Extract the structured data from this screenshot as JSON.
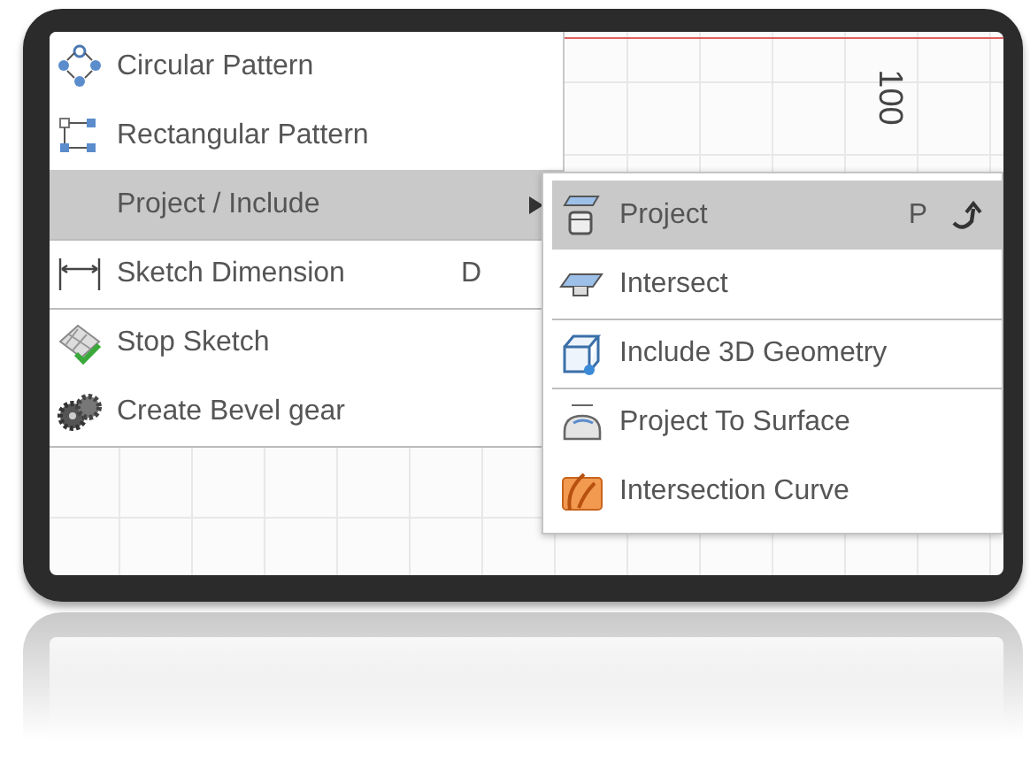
{
  "canvas": {
    "ruler_label": "100"
  },
  "menu": {
    "items": [
      {
        "label": "Circular Pattern",
        "kind": "command",
        "selected": false,
        "separated": false
      },
      {
        "label": "Rectangular Pattern",
        "kind": "command",
        "selected": false,
        "separated": false
      },
      {
        "label": "Project / Include",
        "kind": "submenu",
        "selected": true,
        "separated": false
      },
      {
        "label": "Sketch Dimension",
        "kind": "command",
        "selected": false,
        "separated": true,
        "shortcut": "D"
      },
      {
        "label": "Stop Sketch",
        "kind": "command",
        "selected": false,
        "separated": true
      },
      {
        "label": "Create Bevel gear",
        "kind": "command",
        "selected": false,
        "separated": false
      }
    ]
  },
  "submenu": {
    "items": [
      {
        "label": "Project",
        "selected": true,
        "separated": false,
        "shortcut": "P",
        "repeat": true
      },
      {
        "label": "Intersect",
        "selected": false,
        "separated": false,
        "repeat": false
      },
      {
        "label": "Include 3D Geometry",
        "selected": false,
        "separated": true,
        "repeat": false
      },
      {
        "label": "Project To Surface",
        "selected": false,
        "separated": true,
        "repeat": false
      },
      {
        "label": "Intersection Curve",
        "selected": false,
        "separated": false,
        "repeat": false
      }
    ]
  }
}
